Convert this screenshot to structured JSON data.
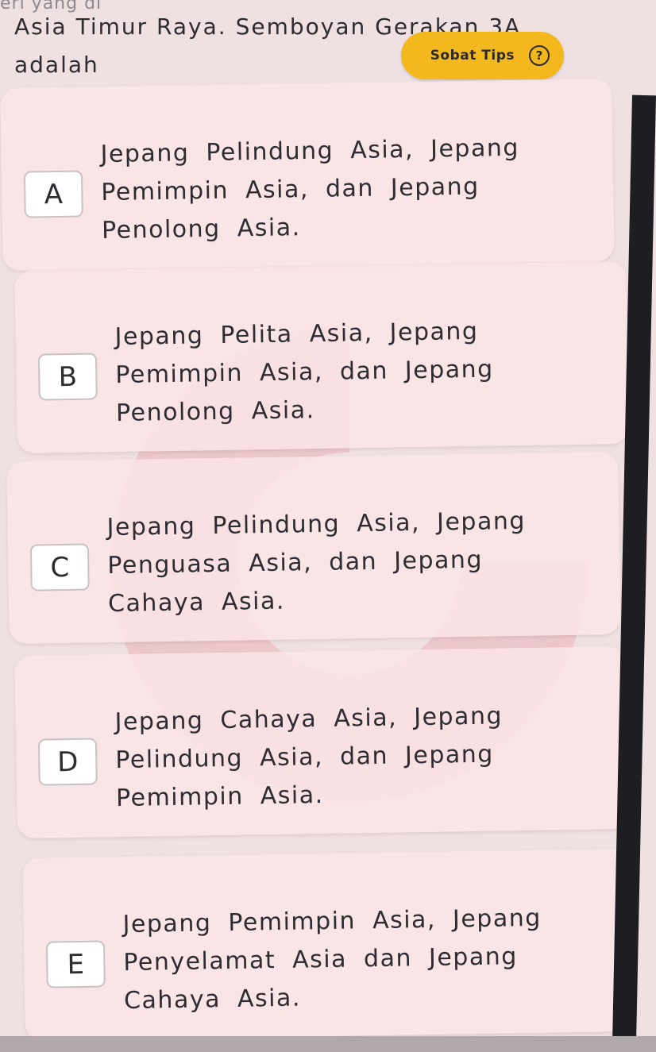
{
  "question": {
    "top_fragment": "eri yang di",
    "line1": "Asia Timur Raya. Semboyan Gerakan 3A",
    "line2": "adalah"
  },
  "sobat_tips": {
    "label": "Sobat Tips",
    "icon": "help-circle-icon",
    "icon_glyph": "?",
    "color": "#f2b81e"
  },
  "options": [
    {
      "letter": "A",
      "text": "Jepang Pelindung Asia, Jepang Pemimpin Asia, dan Jepang Penolong Asia."
    },
    {
      "letter": "B",
      "text": "Jepang Pelita Asia, Jepang Pemimpin Asia, dan Jepang Penolong Asia."
    },
    {
      "letter": "C",
      "text": "Jepang Pelindung Asia, Jepang Penguasa Asia, dan Jepang Cahaya Asia."
    },
    {
      "letter": "D",
      "text": "Jepang Cahaya Asia, Jepang Pelindung Asia, dan Jepang Pemimpin Asia."
    },
    {
      "letter": "E",
      "text": "Jepang Pemimpin Asia, Jepang Penyelamat Asia dan Jepang Cahaya Asia."
    }
  ]
}
